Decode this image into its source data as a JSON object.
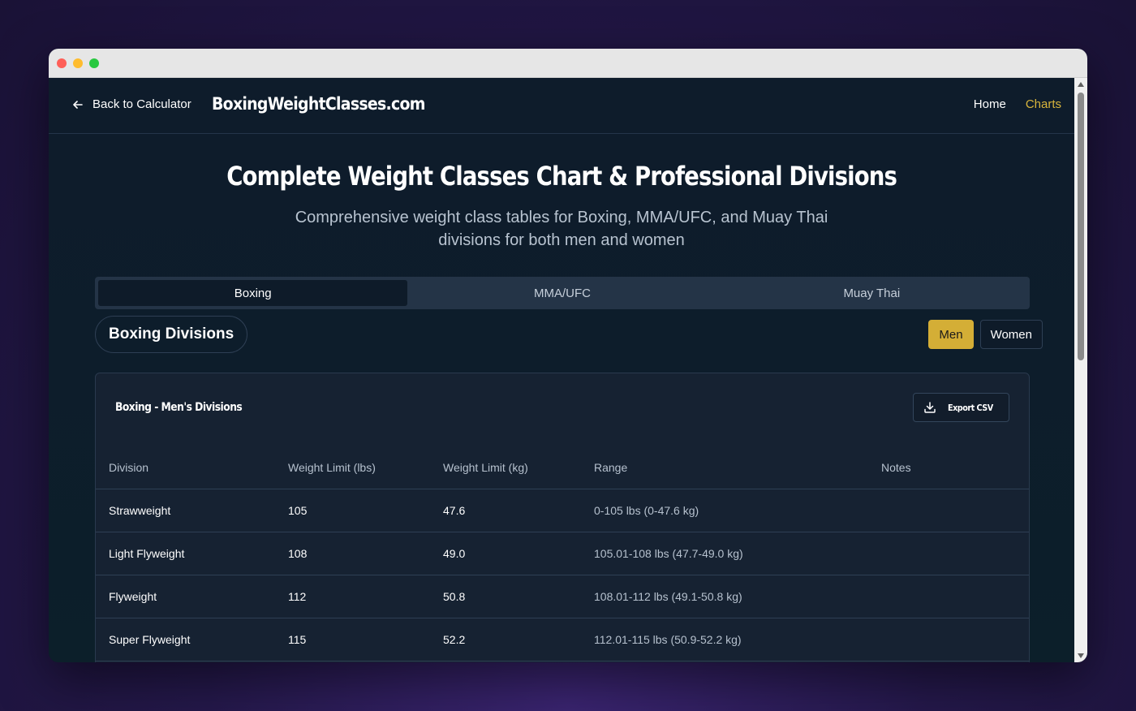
{
  "nav": {
    "back_label": "Back to Calculator",
    "brand": "BoxingWeightClasses.com",
    "links": [
      {
        "label": "Home",
        "active": false
      },
      {
        "label": "Charts",
        "active": true
      }
    ]
  },
  "hero": {
    "title": "Complete Weight Classes Chart & Professional Divisions",
    "subtitle": "Comprehensive weight class tables for Boxing, MMA/UFC, and Muay Thai divisions for both men and women"
  },
  "tabs": [
    {
      "label": "Boxing",
      "active": true
    },
    {
      "label": "MMA/UFC",
      "active": false
    },
    {
      "label": "Muay Thai",
      "active": false
    }
  ],
  "section": {
    "title": "Boxing Divisions",
    "gender": [
      {
        "label": "Men",
        "active": true
      },
      {
        "label": "Women",
        "active": false
      }
    ]
  },
  "card": {
    "title": "Boxing - Men's Divisions",
    "export_label": "Export CSV",
    "columns": [
      "Division",
      "Weight Limit (lbs)",
      "Weight Limit (kg)",
      "Range",
      "Notes"
    ],
    "rows": [
      {
        "division": "Strawweight",
        "lbs": "105",
        "kg": "47.6",
        "range": "0-105 lbs (0-47.6 kg)",
        "notes": ""
      },
      {
        "division": "Light Flyweight",
        "lbs": "108",
        "kg": "49.0",
        "range": "105.01-108 lbs (47.7-49.0 kg)",
        "notes": ""
      },
      {
        "division": "Flyweight",
        "lbs": "112",
        "kg": "50.8",
        "range": "108.01-112 lbs (49.1-50.8 kg)",
        "notes": ""
      },
      {
        "division": "Super Flyweight",
        "lbs": "115",
        "kg": "52.2",
        "range": "112.01-115 lbs (50.9-52.2 kg)",
        "notes": ""
      }
    ]
  },
  "colors": {
    "accent": "#d4ae36",
    "background": "#0d1b2a",
    "card": "#162232"
  }
}
